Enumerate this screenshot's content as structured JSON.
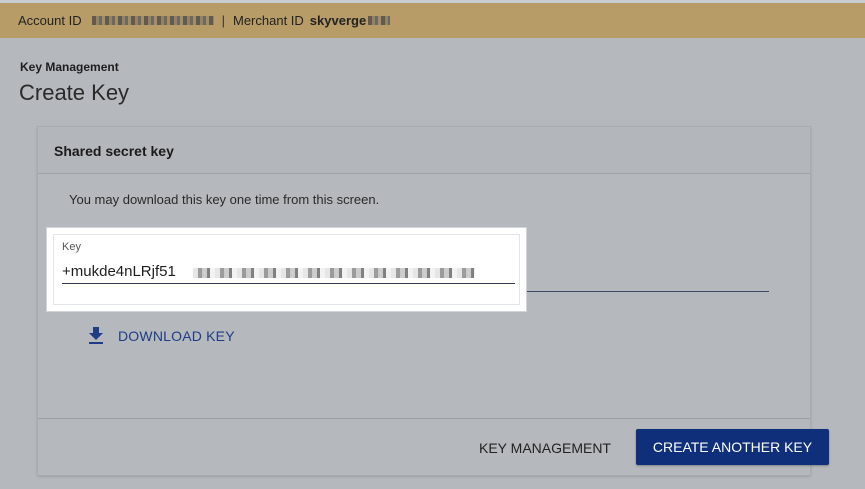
{
  "header": {
    "account_label": "Account ID",
    "separator": "|",
    "merchant_label": "Merchant ID",
    "merchant_value": "skyverge"
  },
  "breadcrumb": "Key Management",
  "page_title": "Create Key",
  "card": {
    "title": "Shared secret key",
    "notice": "You may download this key one time from this screen.",
    "key_field": {
      "label": "Key",
      "value": "+mukde4nLRjf51"
    },
    "download_label": "DOWNLOAD KEY",
    "footer": {
      "key_management_label": "KEY MANAGEMENT",
      "create_another_label": "CREATE ANOTHER KEY"
    }
  },
  "colors": {
    "header_bar": "#b89c68",
    "primary_button": "#0f2f7a",
    "link": "#1f3d87",
    "overlay_bg": "#b5b8bc"
  },
  "icons": {
    "download": "download-icon"
  }
}
